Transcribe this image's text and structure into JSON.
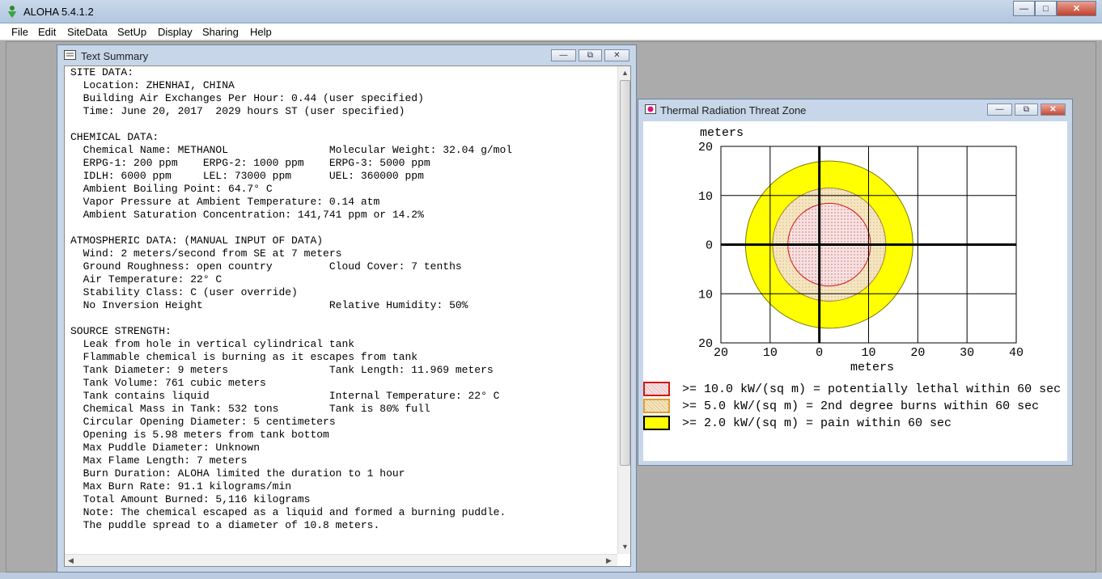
{
  "app": {
    "title": "ALOHA 5.4.1.2",
    "menu": [
      "File",
      "Edit",
      "SiteData",
      "SetUp",
      "Display",
      "Sharing",
      "Help"
    ]
  },
  "text_summary": {
    "title": "Text Summary",
    "lines": [
      "SITE DATA:",
      "  Location: ZHENHAI, CHINA",
      "  Building Air Exchanges Per Hour: 0.44 (user specified)",
      "  Time: June 20, 2017  2029 hours ST (user specified)",
      "",
      "CHEMICAL DATA:",
      "  Chemical Name: METHANOL                Molecular Weight: 32.04 g/mol",
      "  ERPG-1: 200 ppm    ERPG-2: 1000 ppm    ERPG-3: 5000 ppm",
      "  IDLH: 6000 ppm     LEL: 73000 ppm      UEL: 360000 ppm",
      "  Ambient Boiling Point: 64.7° C",
      "  Vapor Pressure at Ambient Temperature: 0.14 atm",
      "  Ambient Saturation Concentration: 141,741 ppm or 14.2%",
      "",
      "ATMOSPHERIC DATA: (MANUAL INPUT OF DATA)",
      "  Wind: 2 meters/second from SE at 7 meters",
      "  Ground Roughness: open country         Cloud Cover: 7 tenths",
      "  Air Temperature: 22° C",
      "  Stability Class: C (user override)",
      "  No Inversion Height                    Relative Humidity: 50%",
      "",
      "SOURCE STRENGTH:",
      "  Leak from hole in vertical cylindrical tank",
      "  Flammable chemical is burning as it escapes from tank",
      "  Tank Diameter: 9 meters                Tank Length: 11.969 meters",
      "  Tank Volume: 761 cubic meters",
      "  Tank contains liquid                   Internal Temperature: 22° C",
      "  Chemical Mass in Tank: 532 tons        Tank is 80% full",
      "  Circular Opening Diameter: 5 centimeters",
      "  Opening is 5.98 meters from tank bottom",
      "  Max Puddle Diameter: Unknown",
      "  Max Flame Length: 7 meters",
      "  Burn Duration: ALOHA limited the duration to 1 hour",
      "  Max Burn Rate: 91.1 kilograms/min",
      "  Total Amount Burned: 5,116 kilograms",
      "  Note: The chemical escaped as a liquid and formed a burning puddle.",
      "  The puddle spread to a diameter of 10.8 meters."
    ]
  },
  "threat_zone": {
    "title": "Thermal Radiation Threat Zone",
    "legend": [
      {
        "label": ">= 10.0 kW/(sq m) = potentially lethal within 60 sec",
        "fill": "#f4d6d6",
        "border": "#d01818"
      },
      {
        "label": ">= 5.0 kW/(sq m) = 2nd degree burns within 60 sec",
        "fill": "#f3e2b4",
        "border": "#e0a030"
      },
      {
        "label": ">= 2.0 kW/(sq m) = pain within 60 sec",
        "fill": "#ffff00",
        "border": "#000000"
      }
    ]
  },
  "chart_data": {
    "type": "area",
    "xlabel": "meters",
    "ylabel": "meters",
    "xlim": [
      -20,
      40
    ],
    "ylim": [
      -20,
      20
    ],
    "x_tick_labels": [
      "20",
      "10",
      "0",
      "10",
      "20",
      "30",
      "40"
    ],
    "y_tick_labels": [
      "20",
      "10",
      "0",
      "10",
      "20"
    ],
    "x_ticks": [
      -20,
      -10,
      0,
      10,
      20,
      30,
      40
    ],
    "y_ticks": [
      20,
      10,
      0,
      -10,
      -20
    ],
    "grid": true,
    "zones": [
      {
        "name": ">= 2.0 kW/(sq m)",
        "center": [
          2,
          0
        ],
        "radius": 17,
        "color": "#ffff00"
      },
      {
        "name": ">= 5.0 kW/(sq m)",
        "center": [
          2,
          0
        ],
        "radius": 11.5,
        "color": "#f3e2b4"
      },
      {
        "name": ">= 10.0 kW/(sq m)",
        "center": [
          2,
          0
        ],
        "radius": 8.4,
        "color": "#f4d6d6"
      }
    ]
  }
}
